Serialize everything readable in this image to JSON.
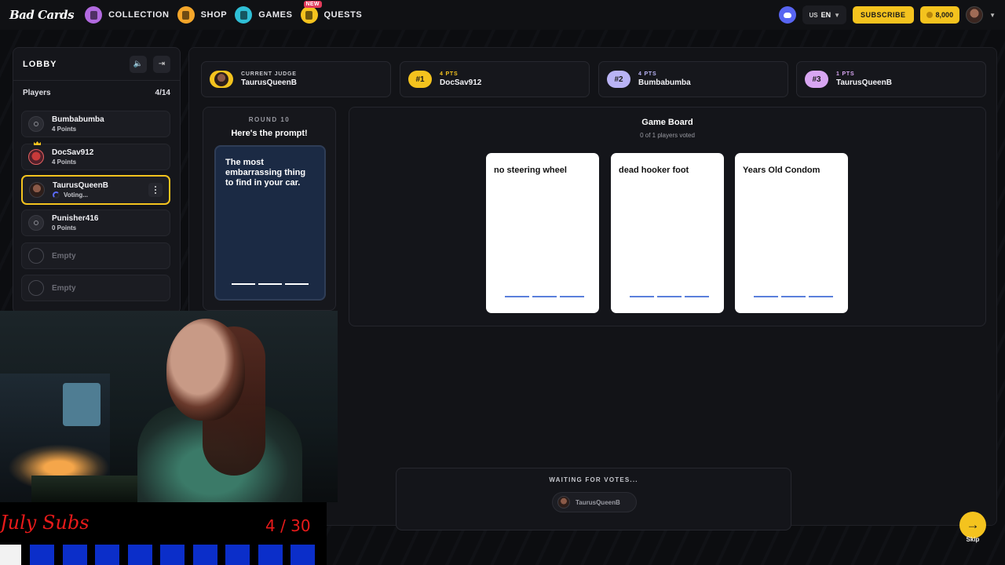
{
  "nav": {
    "logo": "Bad Cards",
    "items": [
      {
        "label": "COLLECTION",
        "color": "#b26ae0"
      },
      {
        "label": "SHOP",
        "color": "#f4a62a"
      },
      {
        "label": "GAMES",
        "color": "#2fbfd6"
      },
      {
        "label": "QUESTS",
        "color": "#f4c31e",
        "badge": "NEW"
      }
    ],
    "lang_region": "US",
    "lang_code": "EN",
    "subscribe": "SUBSCRIBE",
    "coins": "8,000"
  },
  "lobby": {
    "title": "LOBBY",
    "players_label": "Players",
    "players_count": "4/14",
    "players": [
      {
        "name": "Bumbabumba",
        "status": "4 Points"
      },
      {
        "name": "DocSav912",
        "status": "4 Points"
      },
      {
        "name": "TaurusQueenB",
        "status": "Voting..."
      },
      {
        "name": "Punisher416",
        "status": "0 Points"
      }
    ],
    "empty_label": "Empty"
  },
  "scores": [
    {
      "small": "CURRENT JUDGE",
      "name": "TaurusQueenB"
    },
    {
      "rank": "#1",
      "small": "4 PTS",
      "name": "DocSav912",
      "color": "#f4c31e"
    },
    {
      "rank": "#2",
      "small": "4 PTS",
      "name": "Bumbabumba",
      "color": "#b9b3f5"
    },
    {
      "rank": "#3",
      "small": "1 PTS",
      "name": "TaurusQueenB",
      "color": "#d8a6f2"
    }
  ],
  "prompt": {
    "round": "ROUND 10",
    "heading": "Here's the prompt!",
    "text": "The most embarrassing thing to find in your car."
  },
  "board": {
    "title": "Game Board",
    "subtitle": "0 of 1 players voted",
    "cards": [
      "no steering wheel",
      "dead hooker foot",
      "Years Old Condom"
    ]
  },
  "waiting": {
    "title": "WAITING FOR VOTES...",
    "player": "TaurusQueenB"
  },
  "skip_label": "Skip",
  "overlay": {
    "subs_label": "July Subs",
    "subs_count": "4 / 30"
  }
}
